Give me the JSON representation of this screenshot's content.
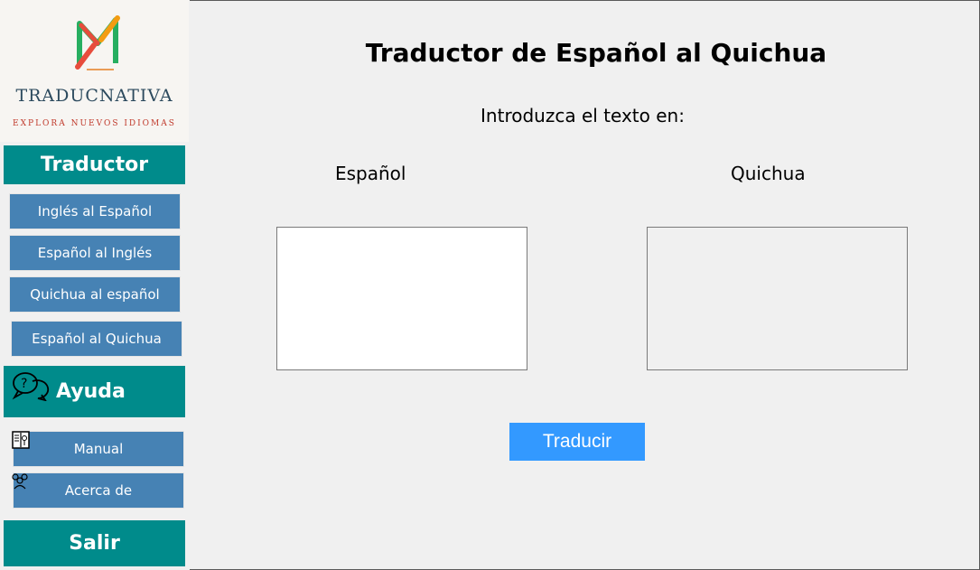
{
  "brand": {
    "name": "TRADUCNATIVA",
    "tagline": "EXPLORA NUEVOS IDIOMAS"
  },
  "sidebar": {
    "translator_header": "Traductor",
    "translator_items": [
      {
        "label": "Inglés al Español"
      },
      {
        "label": "Español al Inglés"
      },
      {
        "label": "Quichua al español"
      },
      {
        "label": "Español al Quichua"
      }
    ],
    "help_header": "Ayuda",
    "help_items": [
      {
        "label": "Manual",
        "icon": "manual-book-icon"
      },
      {
        "label": "Acerca de",
        "icon": "people-group-icon"
      }
    ],
    "exit_label": "Salir"
  },
  "main": {
    "title": "Traductor de Español al Quichua",
    "subtitle": "Introduzca el texto en:",
    "source_language": "Español",
    "target_language": "Quichua",
    "source_text": "",
    "target_text": "",
    "translate_button": "Traducir"
  },
  "colors": {
    "teal_header": "#008b8b",
    "nav_button": "#4682b4",
    "translate_button": "#3399ff",
    "background": "#f0f0f0"
  }
}
